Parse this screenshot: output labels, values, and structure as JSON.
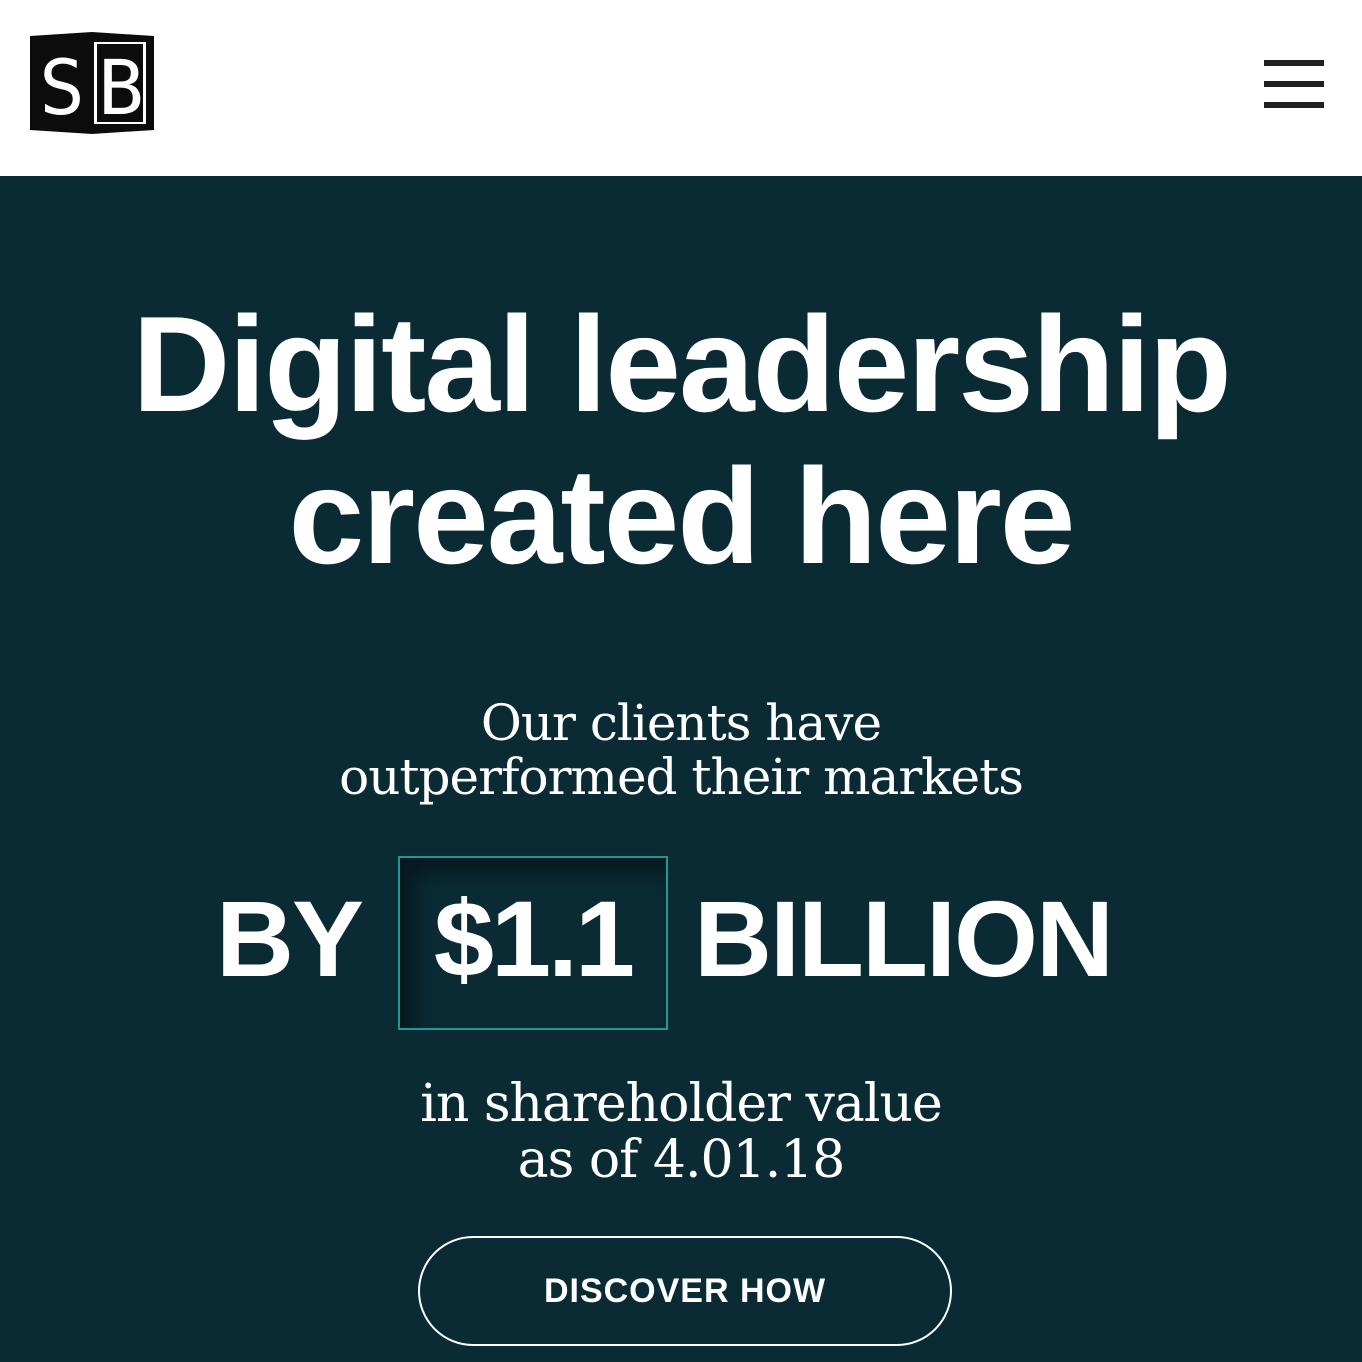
{
  "header": {
    "logo": {
      "text": "SB",
      "icon": "sb-logo"
    },
    "menu": {
      "icon": "hamburger-menu-icon"
    }
  },
  "hero": {
    "headline": {
      "line1": "Digital leadership",
      "line2": "created here"
    },
    "subtitle": {
      "line1": "Our clients have",
      "line2": "outperformed their markets"
    },
    "stat": {
      "prefix": "BY",
      "value": "$1.1",
      "unit": "BILLION"
    },
    "caption": {
      "line1": "in shareholder value",
      "line2": "as of 4.01.18"
    },
    "cta": {
      "label": "DISCOVER HOW"
    }
  },
  "colors": {
    "header_background": "#ffffff",
    "hero_background": "#0a2b34",
    "accent_border": "#1e9a96",
    "text_light": "#ffffff",
    "icon_dark": "#1f2024"
  }
}
